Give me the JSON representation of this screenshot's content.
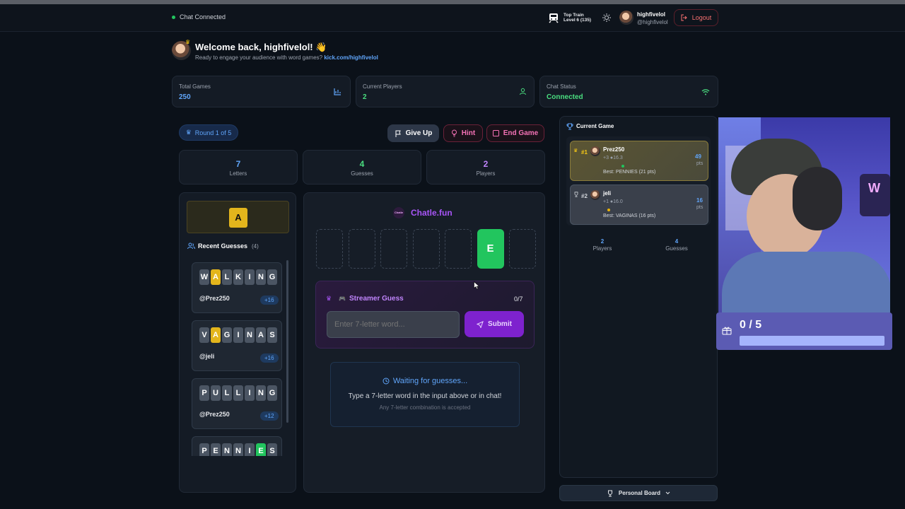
{
  "nav": {
    "status": "Chat Connected",
    "train_title": "Top Train",
    "train_level": "Level 6 (135)",
    "username": "highfivelol",
    "handle": "@highfivelol",
    "logout": "Logout"
  },
  "welcome": {
    "title": "Welcome back, highfivelol! 👋",
    "sub_prefix": "Ready to engage your audience with word games?",
    "link": "kick.com/highfivelol"
  },
  "stats": [
    {
      "label": "Total Games",
      "value": "250"
    },
    {
      "label": "Current Players",
      "value": "2"
    },
    {
      "label": "Chat Status",
      "value": "Connected"
    }
  ],
  "round": "Round 1 of 5",
  "actions": {
    "give_up": "Give Up",
    "hint": "Hint",
    "end_game": "End Game"
  },
  "counters": [
    {
      "value": "7",
      "label": "Letters"
    },
    {
      "value": "4",
      "label": "Guesses"
    },
    {
      "value": "2",
      "label": "Players"
    }
  ],
  "hint_letter": "A",
  "recent": {
    "title": "Recent Guesses",
    "count": "(4)",
    "guesses": [
      {
        "letters": [
          "W",
          "A",
          "L",
          "K",
          "I",
          "N",
          "G"
        ],
        "states": [
          "n",
          "y",
          "n",
          "n",
          "n",
          "n",
          "n"
        ],
        "user": "@Prez250",
        "pts": "+16"
      },
      {
        "letters": [
          "V",
          "A",
          "G",
          "I",
          "N",
          "A",
          "S"
        ],
        "states": [
          "n",
          "y",
          "n",
          "n",
          "n",
          "n",
          "n"
        ],
        "user": "@jeli",
        "pts": "+16"
      },
      {
        "letters": [
          "P",
          "U",
          "L",
          "L",
          "I",
          "N",
          "G"
        ],
        "states": [
          "n",
          "n",
          "n",
          "n",
          "n",
          "n",
          "n"
        ],
        "user": "@Prez250",
        "pts": "+12"
      },
      {
        "letters": [
          "P",
          "E",
          "N",
          "N",
          "I",
          "E",
          "S"
        ],
        "states": [
          "n",
          "n",
          "n",
          "n",
          "n",
          "g",
          "n"
        ],
        "user": "",
        "pts": ""
      }
    ]
  },
  "board": {
    "brand": "Chatle.fun",
    "logo_text": "Chatle",
    "revealed": [
      "",
      "",
      "",
      "",
      "",
      "E",
      ""
    ],
    "colors": {
      "revealed": "#22c55e",
      "accent": "#a855f7"
    }
  },
  "guess": {
    "title": "Streamer Guess",
    "count": "0/7",
    "placeholder": "Enter 7-letter word...",
    "submit": "Submit"
  },
  "waiting": {
    "title": "Waiting for guesses...",
    "line1": "Type a 7-letter word in the input above or in chat!",
    "line2": "Any 7-letter combination is accepted"
  },
  "current_game": {
    "title": "Current Game",
    "players": [
      {
        "rank": "#1",
        "name": "Prez250",
        "stats": "+3 ●16.3",
        "pts": "49",
        "pts_label": "pts",
        "best": "Best: PENNIES (21 pts)"
      },
      {
        "rank": "#2",
        "name": "jeli",
        "stats": "+1 ●16.0",
        "pts": "16",
        "pts_label": "pts",
        "best": "Best: VAGINAS (16 pts)"
      }
    ],
    "players_count": "2",
    "players_label": "Players",
    "guesses_count": "4",
    "guesses_label": "Guesses"
  },
  "personal_board": "Personal Board",
  "overlay": {
    "progress_text": "0 / 5",
    "progress": 0
  }
}
